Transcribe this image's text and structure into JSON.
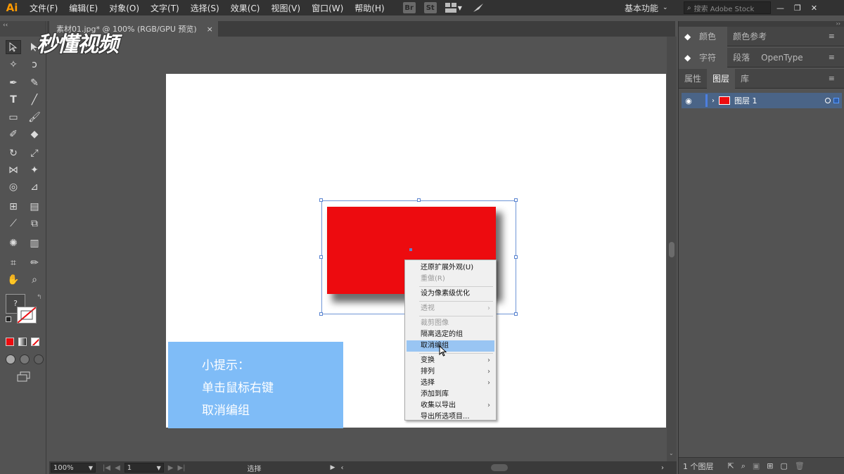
{
  "menubar": {
    "logo": "Ai",
    "items": [
      "文件(F)",
      "编辑(E)",
      "对象(O)",
      "文字(T)",
      "选择(S)",
      "效果(C)",
      "视图(V)",
      "窗口(W)",
      "帮助(H)"
    ],
    "app_icons": [
      "Br",
      "St"
    ],
    "workspace": "基本功能",
    "search_placeholder": "搜索 Adobe Stock"
  },
  "document": {
    "tab_title": "素材01.jpg* @ 100% (RGB/GPU 预览)",
    "close": "×"
  },
  "watermark": "秒懂视频",
  "tip": {
    "line1": "小提示：",
    "line2": "单击鼠标右键",
    "line3": "取消编组"
  },
  "context_menu": {
    "items": [
      {
        "label": "还原扩展外观(U)",
        "disabled": false
      },
      {
        "label": "重做(R)",
        "disabled": true
      },
      {
        "label": "设为像素级优化",
        "disabled": false
      },
      {
        "label": "透视",
        "disabled": true,
        "submenu": true
      },
      {
        "label": "裁剪图像",
        "disabled": true
      },
      {
        "label": "隔离选定的组",
        "disabled": false
      },
      {
        "label": "取消编组",
        "disabled": false,
        "highlighted": true
      },
      {
        "label": "变换",
        "disabled": false,
        "submenu": true
      },
      {
        "label": "排列",
        "disabled": false,
        "submenu": true
      },
      {
        "label": "选择",
        "disabled": false,
        "submenu": true
      },
      {
        "label": "添加到库",
        "disabled": false
      },
      {
        "label": "收集以导出",
        "disabled": false,
        "submenu": true
      },
      {
        "label": "导出所选项目...",
        "disabled": false
      }
    ]
  },
  "status": {
    "zoom": "100%",
    "artboard_number": "1",
    "tool_name": "选择"
  },
  "panels": {
    "color_tabs": [
      "颜色",
      "颜色参考"
    ],
    "char_tabs": [
      "字符",
      "段落",
      "OpenType"
    ],
    "layer_tabs": [
      "属性",
      "图层",
      "库"
    ],
    "layer_name": "图层 1",
    "layer_count": "1 个图层"
  },
  "colors": {
    "rect_fill": "#ed0b0f",
    "tip_bg": "#7fbcf7",
    "menu_highlight": "#99c5f3",
    "selection": "#6f95d6"
  }
}
